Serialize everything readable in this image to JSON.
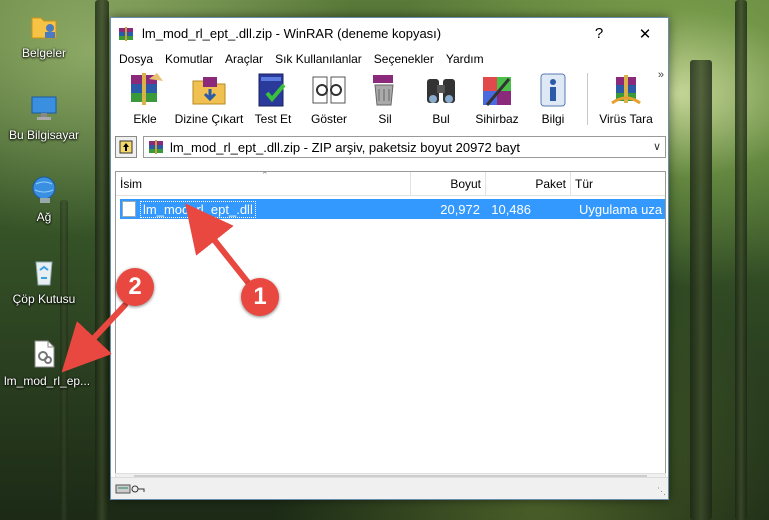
{
  "desktop": {
    "icons": [
      {
        "label": "Belgeler",
        "icon": "documents-folder-icon"
      },
      {
        "label": "Bu Bilgisayar",
        "icon": "computer-icon"
      },
      {
        "label": "Ağ",
        "icon": "network-icon"
      },
      {
        "label": "Çöp Kutusu",
        "icon": "recycle-bin-icon"
      },
      {
        "label": "lm_mod_rl_ep...",
        "icon": "dll-file-icon"
      }
    ]
  },
  "window": {
    "title": "lm_mod_rl_ept_.dll.zip - WinRAR (deneme kopyası)",
    "help_label": "?",
    "close_label": "✕"
  },
  "menu": [
    "Dosya",
    "Komutlar",
    "Araçlar",
    "Sık Kullanılanlar",
    "Seçenekler",
    "Yardım"
  ],
  "toolbar": {
    "buttons": [
      {
        "label": "Ekle",
        "icon": "add-archive-icon"
      },
      {
        "label": "Dizine Çıkart",
        "icon": "extract-to-icon"
      },
      {
        "label": "Test Et",
        "icon": "test-icon"
      },
      {
        "label": "Göster",
        "icon": "view-icon"
      },
      {
        "label": "Sil",
        "icon": "delete-icon"
      },
      {
        "label": "Bul",
        "icon": "find-icon"
      },
      {
        "label": "Sihirbaz",
        "icon": "wizard-icon"
      },
      {
        "label": "Bilgi",
        "icon": "info-icon"
      },
      {
        "label": "Virüs Tara",
        "icon": "virus-scan-icon"
      }
    ],
    "more_label": "»"
  },
  "address": {
    "text": "lm_mod_rl_ept_.dll.zip - ZIP arşiv, paketsiz boyut 20972 bayt"
  },
  "columns": {
    "name": "İsim",
    "size": "Boyut",
    "packed": "Paket",
    "type": "Tür"
  },
  "files": [
    {
      "name": "lm_mod_rl_ept_.dll",
      "size": "20,972",
      "packed": "10,486",
      "type": "Uygulama uza"
    }
  ],
  "annotations": {
    "badge1": "1",
    "badge2": "2"
  },
  "colors": {
    "selection": "#3399ff",
    "annotation": "#e8483f"
  }
}
